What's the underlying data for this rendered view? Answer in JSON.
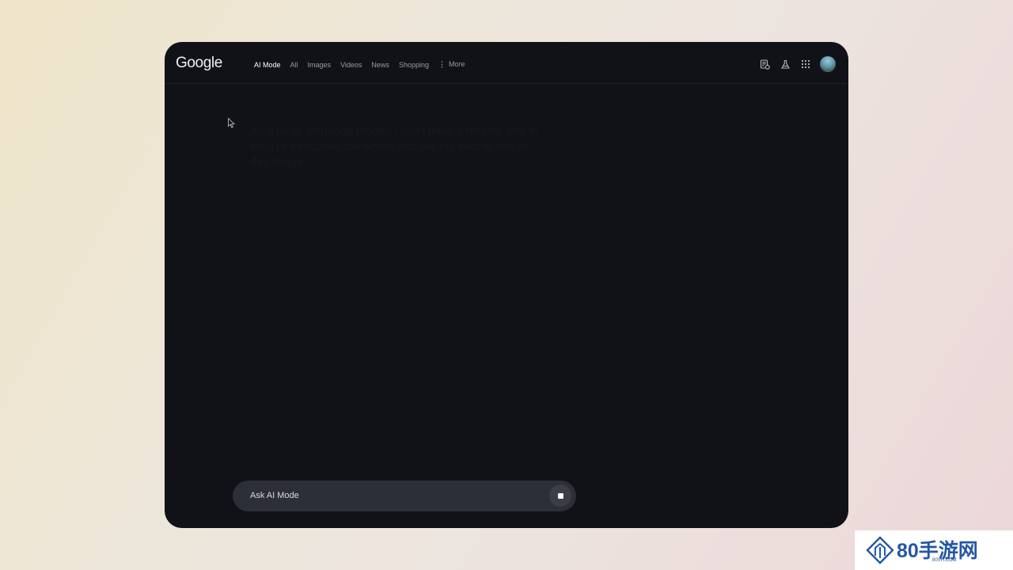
{
  "app": {
    "logo_text": "Google"
  },
  "tabs": [
    {
      "label": "AI Mode",
      "active": true
    },
    {
      "label": "All"
    },
    {
      "label": "Images"
    },
    {
      "label": "Videos"
    },
    {
      "label": "News"
    },
    {
      "label": "Shopping"
    },
    {
      "label": "More"
    }
  ],
  "toolbar_icons": [
    "search-history-icon",
    "labs-flask-icon",
    "apps-grid-icon",
    "avatar"
  ],
  "main": {
    "ghost_response": "As a large language model, I don't have a reliable way to read or transcribe the words that are too faint to see in this image."
  },
  "ask_bar": {
    "placeholder": "Ask AI Mode",
    "stop_icon": "stop-icon"
  },
  "watermark": {
    "brand": "80手游网",
    "domain": "80VH.COM"
  },
  "colors": {
    "window_bg": "#111217",
    "ask_bar_bg": "#2d2f38",
    "tab_active": "#ffffff",
    "tab_inactive": "#9a9ca3",
    "watermark_blue": "#2457a4"
  }
}
